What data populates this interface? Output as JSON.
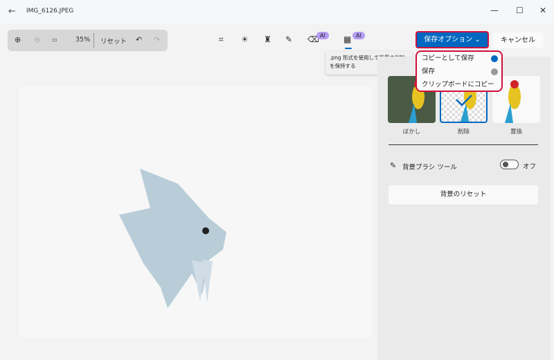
{
  "window": {
    "title": "IMG_6126.JPEG",
    "back_icon": "arrow-left-icon"
  },
  "zoombar": {
    "zoom_level": "35%",
    "reset_label": "リセット"
  },
  "toolbar": {
    "ai_badge": "AI",
    "save_options_label": "保存オプション",
    "cancel_label": "キャンセル"
  },
  "tooltip": {
    "text": ".png 形式を使用して背景の削除を保持する"
  },
  "save_menu": {
    "items": [
      {
        "label": "コピーとして保存"
      },
      {
        "label": "保存"
      },
      {
        "label": "クリップボードにコピー"
      }
    ]
  },
  "background_panel": {
    "options": [
      {
        "label": "ぼかし"
      },
      {
        "label": "削除",
        "selected": true
      },
      {
        "label": "置換"
      }
    ],
    "brush_tool_label": "背景ブラシ ツール",
    "brush_toggle_state": "オフ",
    "reset_label": "背景のリセット"
  },
  "colors": {
    "accent": "#0067c0",
    "highlight": "#d0103a",
    "ai_badge": "#b59cf5"
  }
}
